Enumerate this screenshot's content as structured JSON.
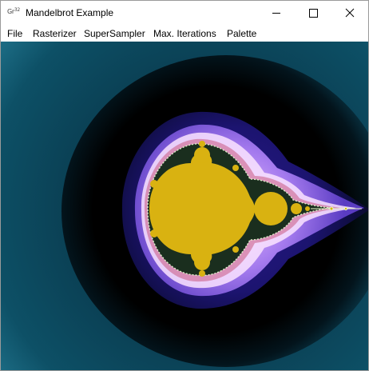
{
  "window": {
    "app_icon_text": "Gr",
    "app_icon_sup": "32",
    "title": "Mandelbrot Example"
  },
  "menu": {
    "file": "File",
    "rasterizer": "Rasterizer",
    "supersampler": "SuperSampler",
    "max_iterations": "Max. Iterations",
    "palette": "Palette"
  },
  "colors": {
    "outer": "#0d5066",
    "dark_halo": "#000000",
    "navy": "#15105a",
    "violet": "#7b52d6",
    "lilac": "#ffe6ff",
    "set_fill": "#d9b211"
  },
  "icons": {
    "minimize": "minimize-icon",
    "maximize": "maximize-icon",
    "close": "close-icon"
  }
}
